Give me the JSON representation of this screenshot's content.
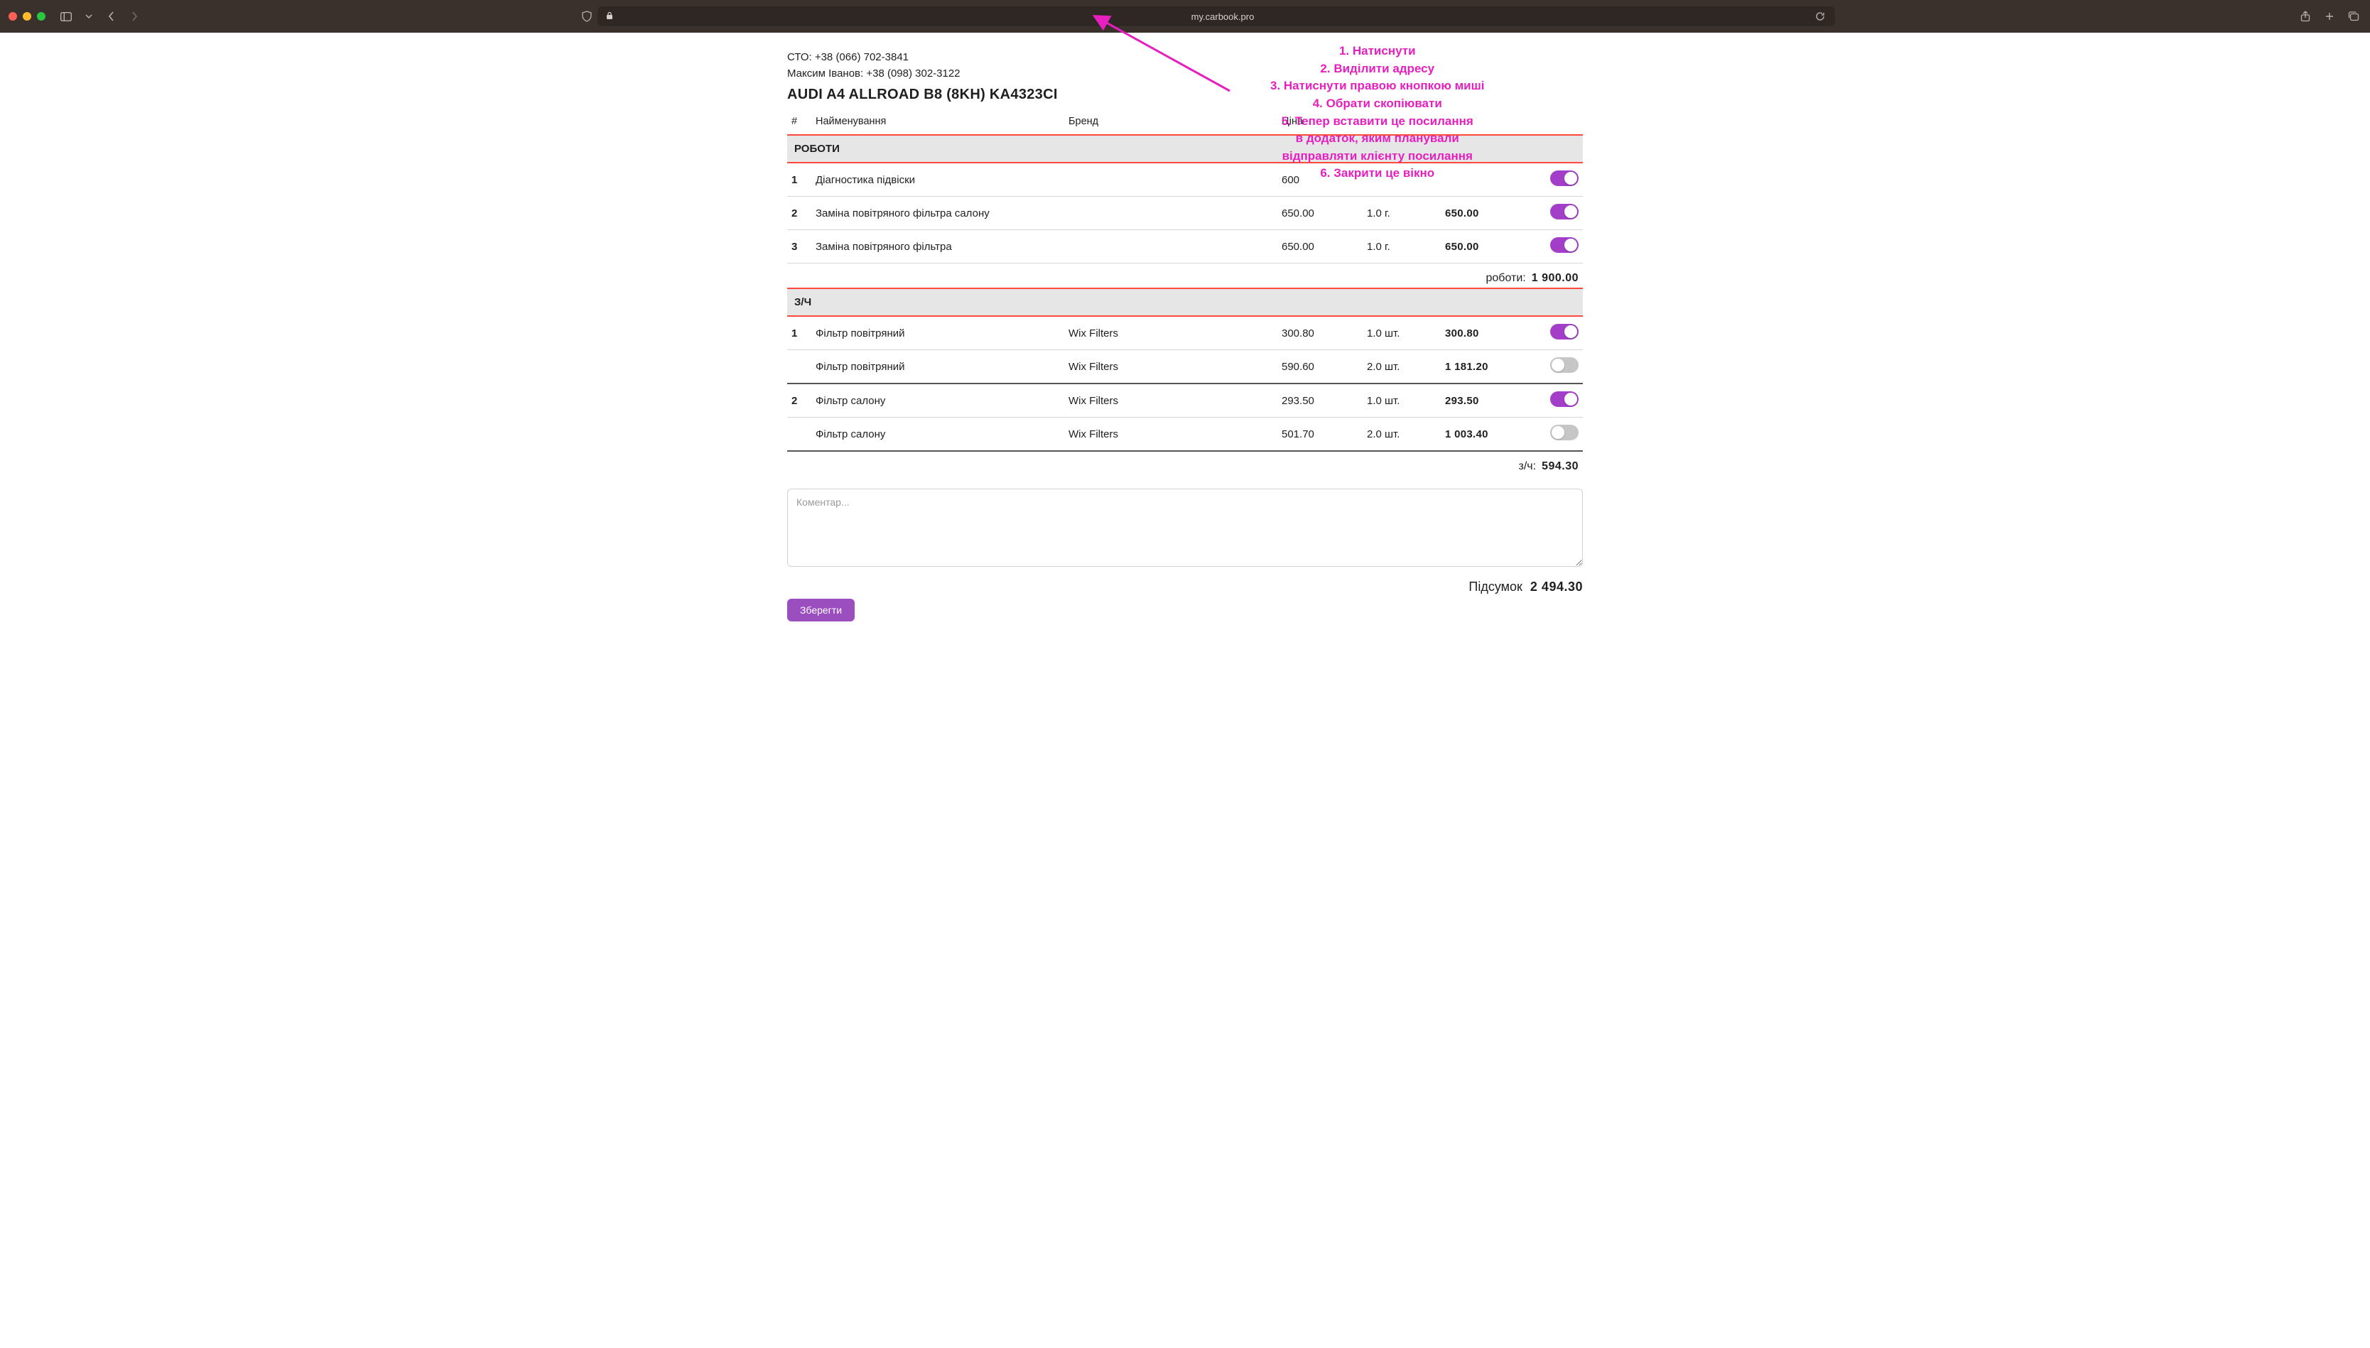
{
  "chrome": {
    "url": "my.carbook.pro"
  },
  "header": {
    "sto_line": "СТО: +38 (066) 702-3841",
    "contact_line": "Максим Іванов: +38 (098) 302-3122",
    "vehicle": "AUDI A4 ALLROAD B8 (8KH) KA4323CI"
  },
  "columns": {
    "idx": "#",
    "name": "Найменування",
    "brand": "Бренд",
    "price": "Ціна",
    "qty": "",
    "sum": "",
    "toggle": ""
  },
  "sections": {
    "works": {
      "title": "РОБОТИ",
      "rows": [
        {
          "idx": "1",
          "name": "Діагностика підвіски",
          "brand": "",
          "price": "600",
          "qty": "",
          "sum": "",
          "on": true
        },
        {
          "idx": "2",
          "name": "Заміна повітряного фільтра салону",
          "brand": "",
          "price": "650.00",
          "qty": "1.0 г.",
          "sum": "650.00",
          "on": true
        },
        {
          "idx": "3",
          "name": "Заміна повітряного фільтра",
          "brand": "",
          "price": "650.00",
          "qty": "1.0 г.",
          "sum": "650.00",
          "on": true
        }
      ],
      "subtotal_label": "роботи:",
      "subtotal_value": "1 900.00"
    },
    "parts": {
      "title": "З/Ч",
      "rows": [
        {
          "idx": "1",
          "name": "Фільтр повітряний",
          "brand": "Wix Filters",
          "price": "300.80",
          "qty": "1.0 шт.",
          "sum": "300.80",
          "on": true,
          "sub": false
        },
        {
          "idx": "",
          "name": "Фільтр повітряний",
          "brand": "Wix Filters",
          "price": "590.60",
          "qty": "2.0 шт.",
          "sum": "1 181.20",
          "on": false,
          "sub": true
        },
        {
          "idx": "2",
          "name": "Фільтр салону",
          "brand": "Wix Filters",
          "price": "293.50",
          "qty": "1.0 шт.",
          "sum": "293.50",
          "on": true,
          "sub": false
        },
        {
          "idx": "",
          "name": "Фільтр салону",
          "brand": "Wix Filters",
          "price": "501.70",
          "qty": "2.0 шт.",
          "sum": "1 003.40",
          "on": false,
          "sub": true
        }
      ],
      "subtotal_label": "з/ч:",
      "subtotal_value": "594.30"
    }
  },
  "comment_placeholder": "Коментар...",
  "final": {
    "label": "Підсумок",
    "value": "2 494.30"
  },
  "save_label": "Зберегти",
  "annotation": {
    "line1": "1. Натиснути",
    "line2": "2. Виділити адресу",
    "line3": "3. Натиснути правою кнопкою миші",
    "line4": "4. Обрати скопіювати",
    "line5": "5. Тепер вставити це посилання",
    "line6": "в додаток, яким планували",
    "line7": "відправляти клієнту посилання",
    "line8": "6. Закрити це вікно"
  }
}
